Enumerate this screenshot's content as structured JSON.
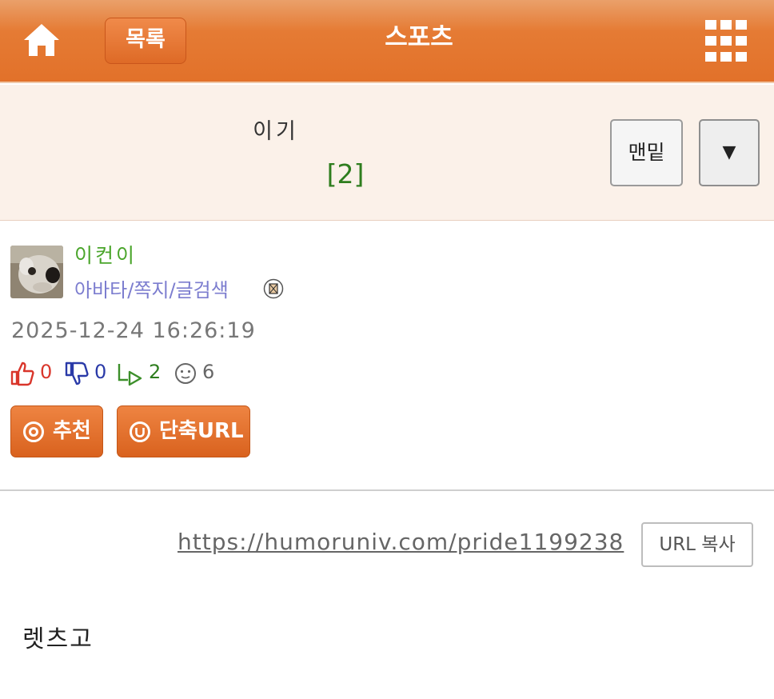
{
  "header": {
    "list_label": "목록",
    "title": "스포츠",
    "icons": {
      "home": "home-icon",
      "menu": "grid-menu-icon"
    },
    "colors": {
      "bar": "#e57b34",
      "bar_light": "#eaa06a"
    }
  },
  "post": {
    "title": "이기",
    "comment_count": "[2]",
    "bottom_label": "맨밑",
    "dropdown_label": "▼"
  },
  "author": {
    "name": "이컨이",
    "links": "아바타/쪽지/글검색",
    "datetime": "2025-12-24 16:26:19"
  },
  "stats": {
    "likes": "0",
    "dislikes": "0",
    "comments": "2",
    "views": "6"
  },
  "actions": {
    "recommend_label": "추천",
    "short_url_label": "단축URL"
  },
  "share": {
    "url": "https://humoruniv.com/pride1199238",
    "copy_label": "URL 복사"
  },
  "body": {
    "text": "렛츠고"
  }
}
